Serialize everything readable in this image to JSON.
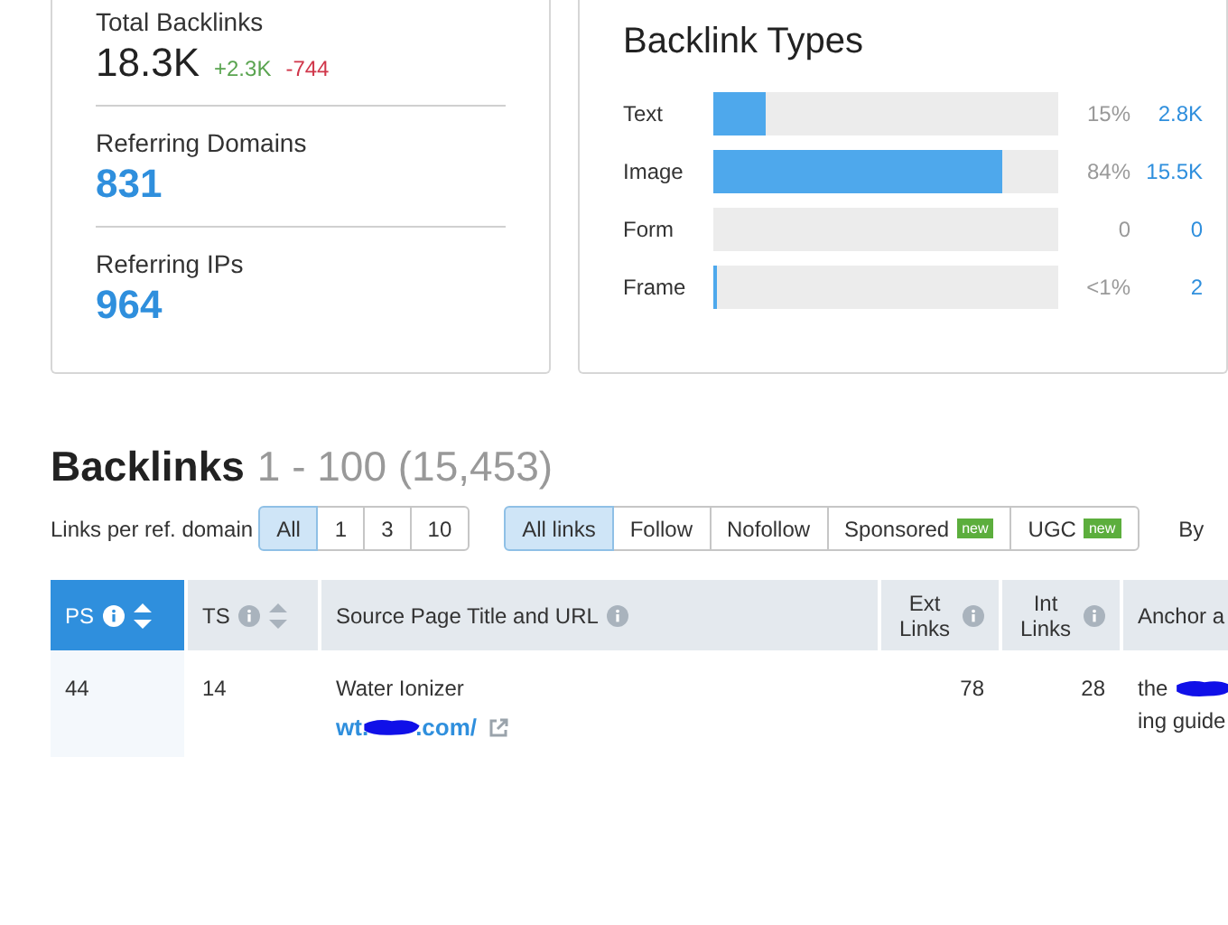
{
  "metrics": [
    {
      "kind": "total",
      "label": "Total Backlinks",
      "value": "18.3K",
      "up": "+2.3K",
      "down": "-744"
    },
    {
      "kind": "count",
      "label": "Referring Domains",
      "value": "831"
    },
    {
      "kind": "count",
      "label": "Referring IPs",
      "value": "964"
    }
  ],
  "backlink_types": {
    "title": "Backlink Types",
    "rows": [
      {
        "label": "Text",
        "level": 0.15,
        "percent": "15%",
        "count": "2.8K"
      },
      {
        "label": "Image",
        "level": 0.84,
        "percent": "84%",
        "count": "15.5K"
      },
      {
        "label": "Form",
        "level": 0,
        "percent": "0",
        "count": "0"
      },
      {
        "label": "Frame",
        "level": 0.01,
        "percent": "<1%",
        "count": "2"
      }
    ]
  },
  "backlinks": {
    "title": "Backlinks",
    "range": "1 - 100 (15,453)",
    "per_domain": {
      "label": "Links per ref. domain",
      "options": [
        {
          "label": "All",
          "selected": true
        },
        {
          "label": "1",
          "selected": false
        },
        {
          "label": "3",
          "selected": false
        },
        {
          "label": "10",
          "selected": false
        }
      ]
    },
    "link_types": [
      {
        "label": "All links",
        "selected": true
      },
      {
        "label": "Follow",
        "selected": false
      },
      {
        "label": "Nofollow",
        "selected": false
      },
      {
        "label": "Sponsored",
        "selected": false,
        "badge": "new"
      },
      {
        "label": "UGC",
        "selected": false,
        "badge": "new"
      }
    ],
    "by_label": "By"
  },
  "table": {
    "columns": [
      {
        "label": "PS",
        "info": true,
        "sortable": true,
        "selected": true
      },
      {
        "label": "TS",
        "info": true,
        "sortable": true,
        "selected": false
      },
      {
        "label": "Source Page Title and URL",
        "info": true,
        "sortable": false,
        "selected": false
      },
      {
        "label": "Ext Links",
        "info": true,
        "sortable": false,
        "selected": false
      },
      {
        "label": "Int Links",
        "info": true,
        "sortable": false,
        "selected": false
      },
      {
        "label": "Anchor a",
        "selected": false
      }
    ],
    "rows": [
      {
        "ps": "44",
        "ts": "14",
        "title": "Water Ionizer",
        "url_start": "wt.",
        "url_end": ".com/",
        "ext": "78",
        "int": "28",
        "anchor_start": "the",
        "anchor_end": "ing guide"
      }
    ]
  }
}
